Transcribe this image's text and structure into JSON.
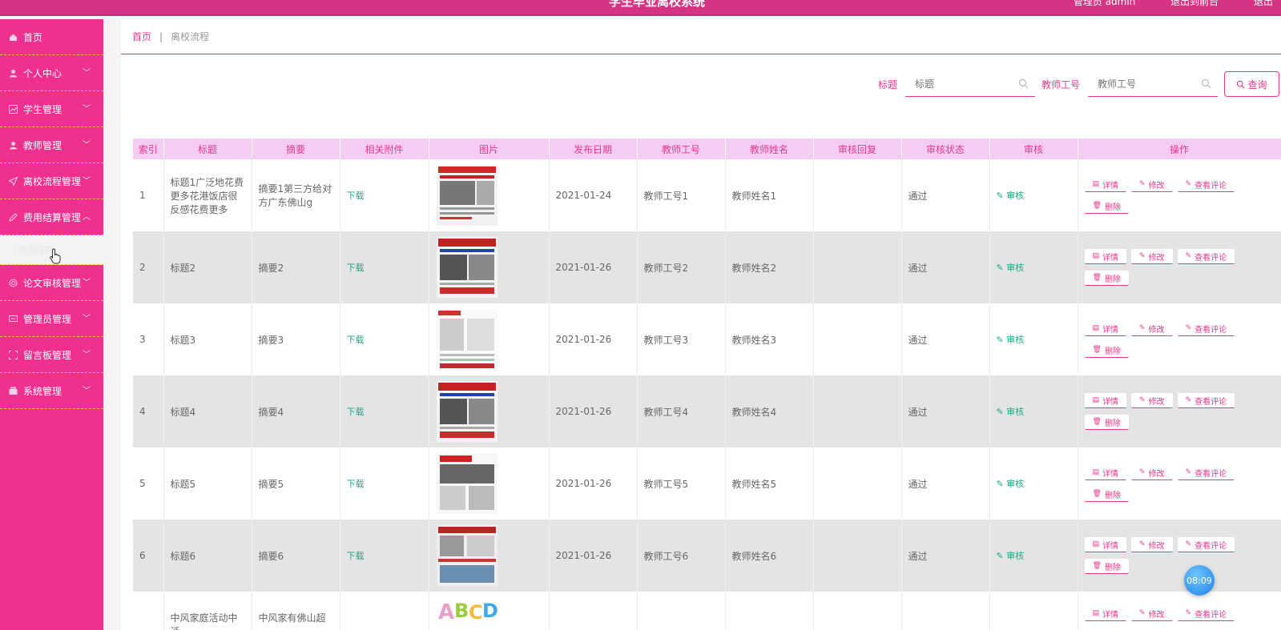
{
  "header": {
    "title": "学生毕业离校系统",
    "right_links": [
      "管理员 admin",
      "退出到前台",
      "退出"
    ]
  },
  "sidebar": {
    "items": [
      {
        "label": "首页",
        "icon": "home-icon"
      },
      {
        "label": "个人中心",
        "icon": "user-icon",
        "chevron": "down"
      },
      {
        "label": "学生管理",
        "icon": "chart-icon",
        "chevron": "down"
      },
      {
        "label": "教师管理",
        "icon": "user-icon",
        "chevron": "down"
      },
      {
        "label": "离校流程管理",
        "icon": "send-icon",
        "chevron": "down"
      },
      {
        "label": "费用结算管理",
        "icon": "pen-icon",
        "chevron": "up"
      },
      {
        "label": "论文审核管理",
        "icon": "circle-icon",
        "chevron": "down"
      },
      {
        "label": "管理员管理",
        "icon": "message-icon",
        "chevron": "down"
      },
      {
        "label": "留言板管理",
        "icon": "frame-icon",
        "chevron": "down"
      },
      {
        "label": "系统管理",
        "icon": "box-icon",
        "chevron": "down"
      }
    ],
    "submenu_label": "费用结算"
  },
  "breadcrumb": {
    "home": "首页",
    "separator": "|",
    "current": "离校流程"
  },
  "search": {
    "title_label": "标题",
    "title_placeholder": "标题",
    "teacher_label": "教师工号",
    "teacher_placeholder": "教师工号",
    "query_button": "查询"
  },
  "table": {
    "columns": [
      "索引",
      "标题",
      "摘要",
      "相关附件",
      "图片",
      "发布日期",
      "教师工号",
      "教师姓名",
      "审核回复",
      "审核状态",
      "审核",
      "操作"
    ],
    "download_label": "下载",
    "review_label": "审核",
    "ops": [
      "详情",
      "修改",
      "查看评论",
      "删除"
    ],
    "rows": [
      {
        "index": "1",
        "title": "标题1广泛地花费更多花港饭店很反感花费更多",
        "summary": "摘要1第三方给对方广东佛山g",
        "date": "2021-01-24",
        "teacher_id": "教师工号1",
        "teacher_name": "教师姓名1",
        "reply": "",
        "status": "通过"
      },
      {
        "index": "2",
        "title": "标题2",
        "summary": "摘要2",
        "date": "2021-01-26",
        "teacher_id": "教师工号2",
        "teacher_name": "教师姓名2",
        "reply": "",
        "status": "通过"
      },
      {
        "index": "3",
        "title": "标题3",
        "summary": "摘要3",
        "date": "2021-01-26",
        "teacher_id": "教师工号3",
        "teacher_name": "教师姓名3",
        "reply": "",
        "status": "通过"
      },
      {
        "index": "4",
        "title": "标题4",
        "summary": "摘要4",
        "date": "2021-01-26",
        "teacher_id": "教师工号4",
        "teacher_name": "教师姓名4",
        "reply": "",
        "status": "通过"
      },
      {
        "index": "5",
        "title": "标题5",
        "summary": "摘要5",
        "date": "2021-01-26",
        "teacher_id": "教师工号5",
        "teacher_name": "教师姓名5",
        "reply": "",
        "status": "通过"
      },
      {
        "index": "6",
        "title": "标题6",
        "summary": "摘要6",
        "date": "2021-01-26",
        "teacher_id": "教师工号6",
        "teacher_name": "教师姓名6",
        "reply": "",
        "status": "通过"
      }
    ],
    "partial_row": {
      "title": "中风家庭活动中活",
      "summary": "中风家有佛山超"
    }
  },
  "clock": "08:09"
}
